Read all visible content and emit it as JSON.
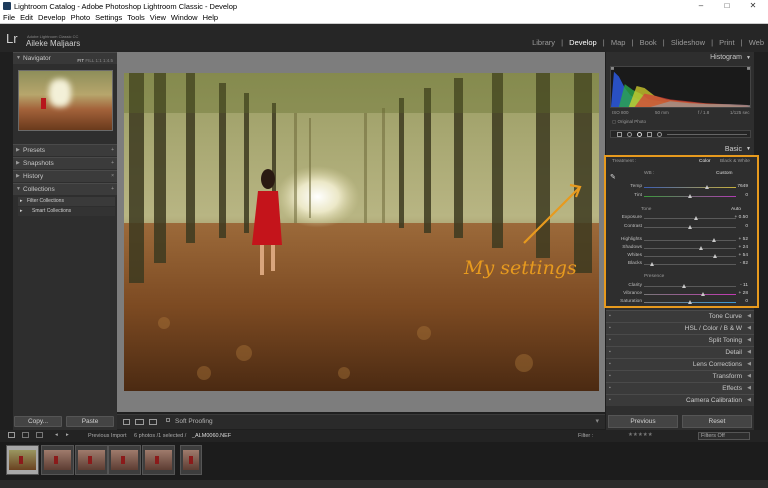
{
  "window": {
    "title": "Lightroom Catalog - Adobe Photoshop Lightroom Classic - Develop",
    "controls": {
      "minimize": "–",
      "maximize": "□",
      "close": "✕"
    }
  },
  "menu": [
    "File",
    "Edit",
    "Develop",
    "Photo",
    "Settings",
    "Tools",
    "View",
    "Window",
    "Help"
  ],
  "identity": {
    "logo": "Lr",
    "app_line": "Adobe Lightroom Classic CC",
    "user": "Aileke Maljaars"
  },
  "modules": [
    "Library",
    "Develop",
    "Map",
    "Book",
    "Slideshow",
    "Print",
    "Web"
  ],
  "active_module": "Develop",
  "left_panel": {
    "navigator": {
      "title": "Navigator",
      "zoom_options": [
        "FIT",
        "FILL",
        "1:1",
        "1:4.5"
      ]
    },
    "panels": [
      "Presets",
      "Snapshots",
      "History",
      "Collections"
    ],
    "collections": [
      "Filter Collections",
      "Smart Collections"
    ],
    "copy_label": "Copy...",
    "paste_label": "Paste"
  },
  "toolbar": {
    "soft_proofing": "Soft Proofing"
  },
  "annotation": {
    "text": "My settings",
    "color": "#e79a1e"
  },
  "right_panel": {
    "histogram": {
      "title": "Histogram",
      "info": [
        "ISO 800",
        "50 mm",
        "f / 1.8",
        "1/125 sec"
      ],
      "original_photo": "Original Photo"
    },
    "basic": {
      "title": "Basic",
      "treatment_label": "Treatment :",
      "treatment_color": "Color",
      "treatment_bw": "Black & White",
      "wb_label": "WB :",
      "wb_value": "Custom",
      "temp": {
        "label": "Temp",
        "value": "7649",
        "pos": 0.68
      },
      "tint": {
        "label": "Tint",
        "value": "0",
        "pos": 0.5
      },
      "tone_label": "Tone",
      "tone_auto": "Auto",
      "exposure": {
        "label": "Exposure",
        "value": "+ 0.50",
        "pos": 0.56
      },
      "contrast": {
        "label": "Contrast",
        "value": "0",
        "pos": 0.5
      },
      "highlights": {
        "label": "Highlights",
        "value": "+ 52",
        "pos": 0.76
      },
      "shadows": {
        "label": "Shadows",
        "value": "+ 24",
        "pos": 0.62
      },
      "whites": {
        "label": "Whites",
        "value": "+ 54",
        "pos": 0.77
      },
      "blacks": {
        "label": "Blacks",
        "value": "- 82",
        "pos": 0.09
      },
      "presence_label": "Presence",
      "clarity": {
        "label": "Clarity",
        "value": "- 11",
        "pos": 0.44
      },
      "vibrance": {
        "label": "Vibrance",
        "value": "+ 28",
        "pos": 0.64
      },
      "saturation": {
        "label": "Saturation",
        "value": "0",
        "pos": 0.5
      }
    },
    "panels": [
      "Tone Curve",
      "HSL / Color / B & W",
      "Split Toning",
      "Detail",
      "Lens Corrections",
      "Transform",
      "Effects",
      "Camera Calibration"
    ],
    "previous_label": "Previous",
    "reset_label": "Reset"
  },
  "filmstrip_bar": {
    "source": "Previous Import",
    "count": "6 photos /1 selected /",
    "filename": "_ALM0060.NEF",
    "filter_label": "Filter :",
    "filters_off": "Filters Off"
  }
}
